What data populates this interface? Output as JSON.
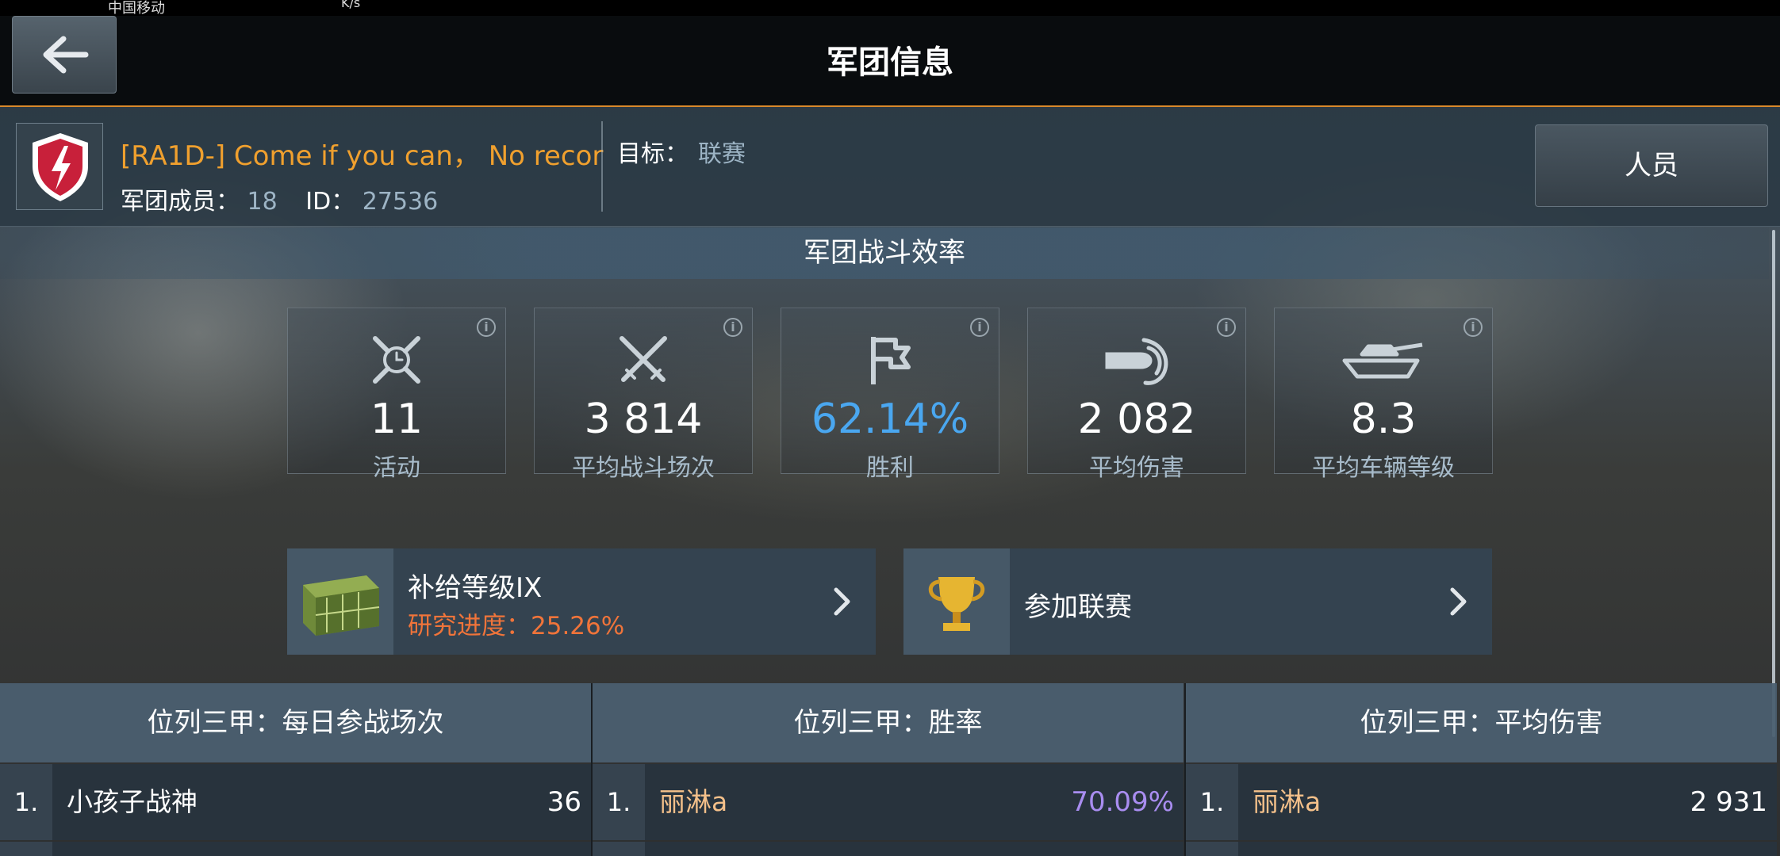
{
  "status_bar": {
    "carrier": "中国移动",
    "speed_unit": "K/s"
  },
  "header": {
    "title": "军团信息",
    "back_icon": "arrow-left-icon"
  },
  "clan": {
    "name": "[RA1D-] Come if you can， No recor",
    "members_label": "军团成员：",
    "members_value": "18",
    "id_label": "ID：",
    "id_value": "27536",
    "goal_label": "目标：",
    "goal_value": "联赛",
    "people_button": "人员"
  },
  "efficiency": {
    "title": "军团战斗效率",
    "stats": [
      {
        "icon": "activity-clock-icon",
        "value": "11",
        "label": "活动"
      },
      {
        "icon": "crossed-swords-icon",
        "value": "3 814",
        "label": "平均战斗场次"
      },
      {
        "icon": "flag-icon",
        "value": "62.14%",
        "label": "胜利"
      },
      {
        "icon": "shell-damage-icon",
        "value": "2 082",
        "label": "平均伤害"
      },
      {
        "icon": "tank-icon",
        "value": "8.3",
        "label": "平均车辆等级"
      }
    ]
  },
  "actions": {
    "supply_title": "补给等级IX",
    "supply_progress": "研究进度：25.26%",
    "league_title": "参加联赛"
  },
  "leaderboards": [
    {
      "title": "位列三甲：每日参战场次",
      "rank": "1.",
      "player": "小孩子战神",
      "score": "36",
      "player_color": "#ffffff",
      "score_color": "#ffffff"
    },
    {
      "title": "位列三甲：胜率",
      "rank": "1.",
      "player": "丽淋a",
      "score": "70.09%",
      "player_color": "#f4c08a",
      "score_color": "#a98df0"
    },
    {
      "title": "位列三甲：平均伤害",
      "rank": "1.",
      "player": "丽淋a",
      "score": "2 931",
      "player_color": "#f4c08a",
      "score_color": "#ffffff"
    }
  ],
  "colors": {
    "accent": "#d9892b",
    "clan_name": "#f0a02e",
    "win_rate": "#4aa7f0",
    "progress": "#f0743a"
  }
}
